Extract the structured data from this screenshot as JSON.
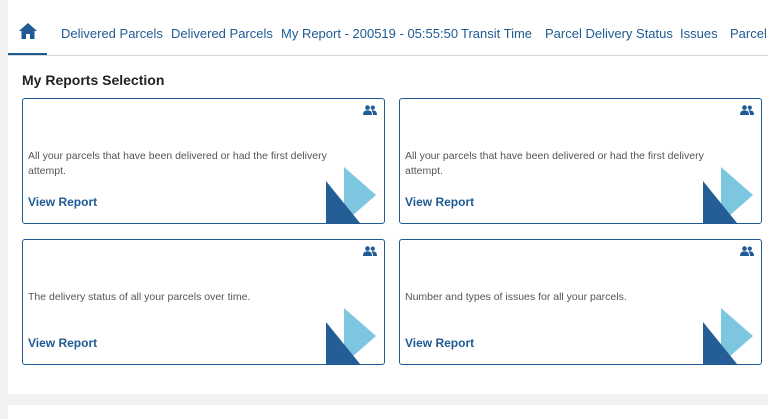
{
  "tabs": [
    {
      "label": "Delivered Parcels"
    },
    {
      "label": "Delivered Parcels"
    },
    {
      "label": "My Report - 200519 - 05:55:50"
    },
    {
      "label": "Transit Time"
    },
    {
      "label": "Parcel Delivery Status"
    },
    {
      "label": "Issues"
    },
    {
      "label": "Parcel"
    }
  ],
  "section": {
    "title": "My Reports Selection"
  },
  "cards": [
    {
      "description": "All your parcels that have been delivered or had the first delivery attempt.",
      "link": "View Report"
    },
    {
      "description": "All your parcels that have been delivered or had the first delivery attempt.",
      "link": "View Report"
    },
    {
      "description": "The delivery status of all your parcels over time.",
      "link": "View Report"
    },
    {
      "description": "Number and types of issues for all your parcels.",
      "link": "View Report"
    }
  ],
  "colors": {
    "brand": "#1f5a94",
    "accent_light": "#7cc6e0",
    "accent_dark": "#255e96"
  },
  "icons": {
    "home": "home-icon",
    "shared": "people-icon"
  }
}
